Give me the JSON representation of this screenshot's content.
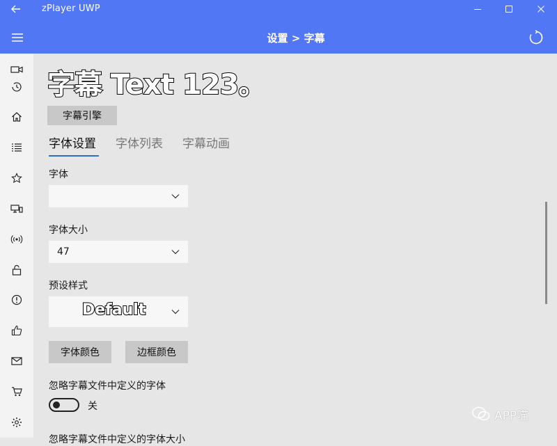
{
  "window": {
    "title": "zPlayer UWP"
  },
  "header": {
    "breadcrumb": "设置 > 字幕"
  },
  "sidebar": {
    "icons": [
      "camera-icon",
      "history-icon",
      "home-icon",
      "list-icon",
      "star-icon",
      "devices-icon",
      "broadcast-icon",
      "lock-icon",
      "info-icon",
      "thumbs-up-icon",
      "mail-icon",
      "cart-icon",
      "settings-icon"
    ]
  },
  "main": {
    "preview_text": "字幕 Text 123。",
    "engine_button": "字幕引擎",
    "tabs": [
      {
        "label": "字体设置"
      },
      {
        "label": "字体列表"
      },
      {
        "label": "字幕动画"
      }
    ],
    "font": {
      "label": "字体",
      "value": ""
    },
    "font_size": {
      "label": "字体大小",
      "value": "47"
    },
    "preset_style": {
      "label": "预设样式",
      "value": "Default"
    },
    "font_color_button": "字体颜色",
    "border_color_button": "边框颜色",
    "ignore_font": {
      "label": "忽略字幕文件中定义的字体",
      "state": "关",
      "on": false
    },
    "next_label": "忽略字幕文件中定义的字体大小"
  },
  "watermark": {
    "text": "APP喵"
  },
  "colors": {
    "accent": "#5277f4",
    "tab_underline": "#2c6ec9",
    "background": "#e6e6e6",
    "sidebar": "#f3f3f3"
  }
}
